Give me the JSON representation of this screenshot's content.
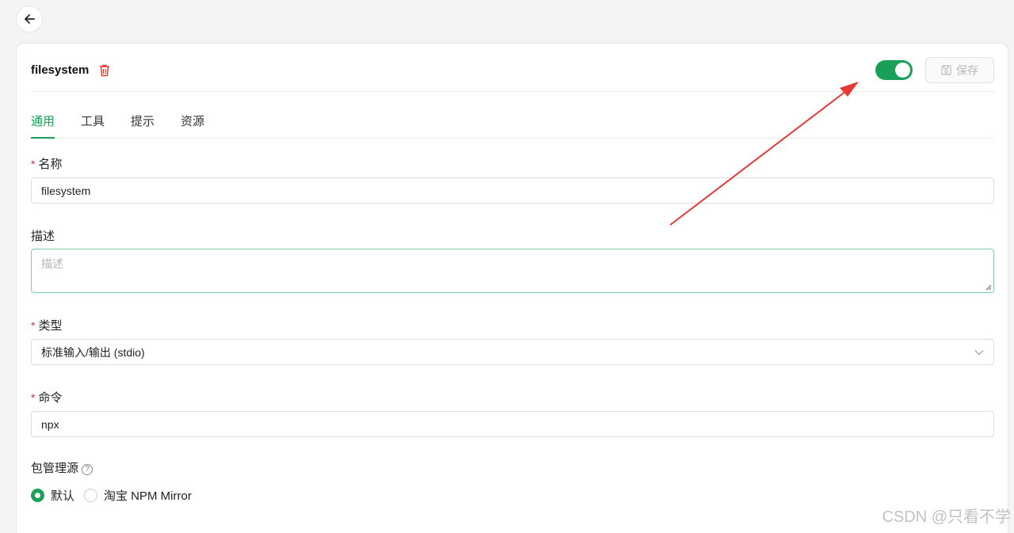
{
  "header": {
    "title": "filesystem",
    "save_label": "保存",
    "enabled": true
  },
  "tabs": [
    {
      "label": "通用",
      "active": true
    },
    {
      "label": "工具",
      "active": false
    },
    {
      "label": "提示",
      "active": false
    },
    {
      "label": "资源",
      "active": false
    }
  ],
  "form": {
    "name": {
      "label": "名称",
      "required": true,
      "value": "filesystem"
    },
    "description": {
      "label": "描述",
      "placeholder": "描述",
      "value": ""
    },
    "type": {
      "label": "类型",
      "required": true,
      "value": "标准输入/输出 (stdio)"
    },
    "command": {
      "label": "命令",
      "required": true,
      "value": "npx"
    },
    "registry": {
      "label": "包管理源",
      "options": [
        {
          "label": "默认",
          "selected": true
        },
        {
          "label": "淘宝 NPM Mirror",
          "selected": false
        }
      ]
    }
  },
  "watermark": "CSDN @只看不学",
  "colors": {
    "accent": "#18a058",
    "danger": "#d03050",
    "annotation_arrow": "#e53935"
  },
  "icons": [
    "back-arrow-icon",
    "trash-icon",
    "save-icon",
    "chevron-down-icon",
    "question-icon"
  ]
}
